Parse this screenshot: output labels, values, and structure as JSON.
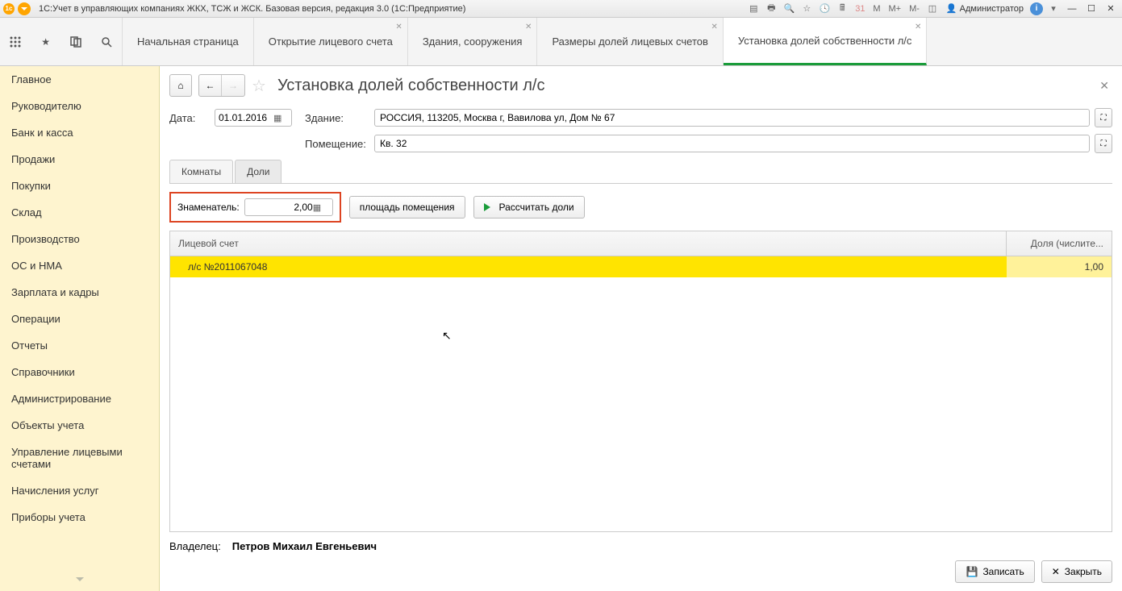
{
  "titlebar": {
    "app_title": "1С:Учет в управляющих компаниях ЖКХ, ТСЖ и ЖСК. Базовая версия, редакция 3.0  (1С:Предприятие)",
    "user": "Администратор",
    "m": "M",
    "m_plus": "M+",
    "m_minus": "M-"
  },
  "tabs": [
    {
      "label": "Начальная страница",
      "closable": false
    },
    {
      "label": "Открытие лицевого счета",
      "closable": true
    },
    {
      "label": "Здания, сооружения",
      "closable": true
    },
    {
      "label": "Размеры долей лицевых счетов",
      "closable": true
    },
    {
      "label": "Установка долей собственности л/с",
      "closable": true,
      "active": true
    }
  ],
  "sidebar": {
    "items": [
      "Главное",
      "Руководителю",
      "Банк и касса",
      "Продажи",
      "Покупки",
      "Склад",
      "Производство",
      "ОС и НМА",
      "Зарплата и кадры",
      "Операции",
      "Отчеты",
      "Справочники",
      "Администрирование",
      "Объекты учета",
      "Управление лицевыми счетами",
      "Начисления услуг",
      "Приборы учета"
    ]
  },
  "page": {
    "title": "Установка долей собственности л/с",
    "date_label": "Дата:",
    "date_value": "01.01.2016",
    "building_label": "Здание:",
    "building_value": "РОССИЯ, 113205, Москва г, Вавилова ул, Дом № 67",
    "room_label": "Помещение:",
    "room_value": "Кв. 32",
    "subtabs": [
      "Комнаты",
      "Доли"
    ],
    "denominator_label": "Знаменатель:",
    "denominator_value": "2,00",
    "area_button": "площадь помещения",
    "calc_button": "Рассчитать доли",
    "table": {
      "col1": "Лицевой счет",
      "col2": "Доля (числите...",
      "rows": [
        {
          "account": "л/с №2011067048",
          "share": "1,00"
        }
      ]
    },
    "owner_label": "Владелец:",
    "owner_value": "Петров Михаил Евгеньевич",
    "save_button": "Записать",
    "close_button": "Закрыть"
  }
}
